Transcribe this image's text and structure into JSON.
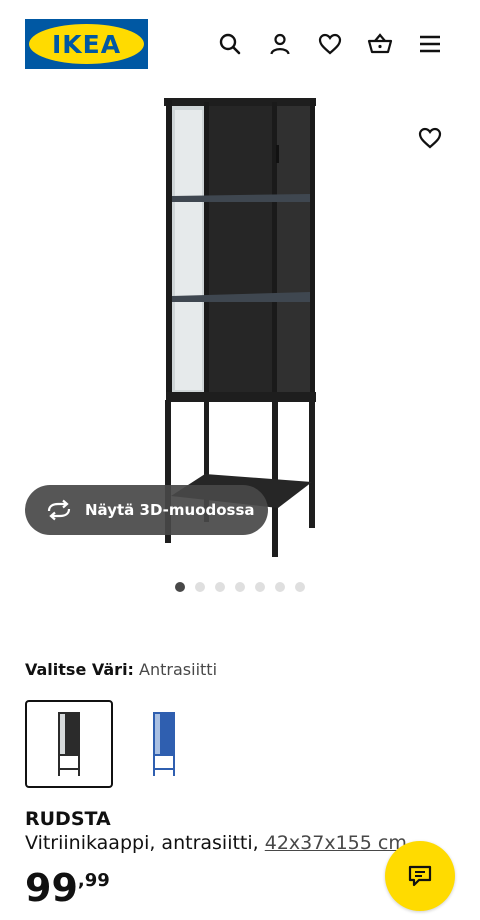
{
  "header": {
    "logo_text": "IKEA",
    "icons": [
      "search-icon",
      "account-icon",
      "favourites-icon",
      "shopping-bag-icon",
      "menu-icon"
    ]
  },
  "product": {
    "favourite_icon": "heart-icon",
    "view_3d_label": "Näytä 3D-muodossa",
    "carousel": {
      "total": 7,
      "active": 1
    },
    "color_label": "Valitse Väri:",
    "color_value": "Antrasiitti",
    "swatches": [
      {
        "name": "Antrasiitti",
        "color": "#2b2b2b",
        "selected": true
      },
      {
        "name": "Sininen",
        "color": "#2f5fb0",
        "selected": false
      }
    ],
    "name": "RUDSTA",
    "description": "Vitriinikaappi, antrasiitti,",
    "dimensions": "42x37x155 cm",
    "price_int": "99",
    "price_dec": ",99"
  },
  "colors": {
    "brand_blue": "#0058a3",
    "brand_yellow": "#ffdb00",
    "cabinet": "#1e1e1e"
  }
}
